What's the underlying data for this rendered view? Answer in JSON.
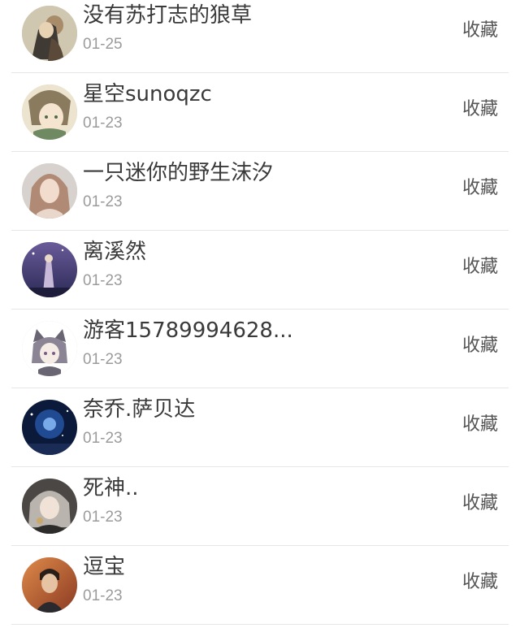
{
  "items": [
    {
      "name": "没有苏打志的狼草",
      "date": "01-25",
      "action": "收藏",
      "avatar": "vintage-couple-avatar-icon"
    },
    {
      "name": "星空sunoqzc",
      "date": "01-23",
      "action": "收藏",
      "avatar": "anime-cat-ear-avatar-icon"
    },
    {
      "name": "一只迷你的野生沫汐",
      "date": "01-23",
      "action": "收藏",
      "avatar": "girl-portrait-avatar-icon"
    },
    {
      "name": "离溪然",
      "date": "01-23",
      "action": "收藏",
      "avatar": "night-sky-avatar-icon"
    },
    {
      "name": "游客15789994628...",
      "date": "01-23",
      "action": "收藏",
      "avatar": "anime-catgirl-avatar-icon"
    },
    {
      "name": "奈乔.萨贝达",
      "date": "01-23",
      "action": "收藏",
      "avatar": "blue-galaxy-avatar-icon"
    },
    {
      "name": "死神..",
      "date": "01-23",
      "action": "收藏",
      "avatar": "anime-grey-hair-avatar-icon"
    },
    {
      "name": "逗宝",
      "date": "01-23",
      "action": "收藏",
      "avatar": "man-portrait-avatar-icon"
    }
  ]
}
